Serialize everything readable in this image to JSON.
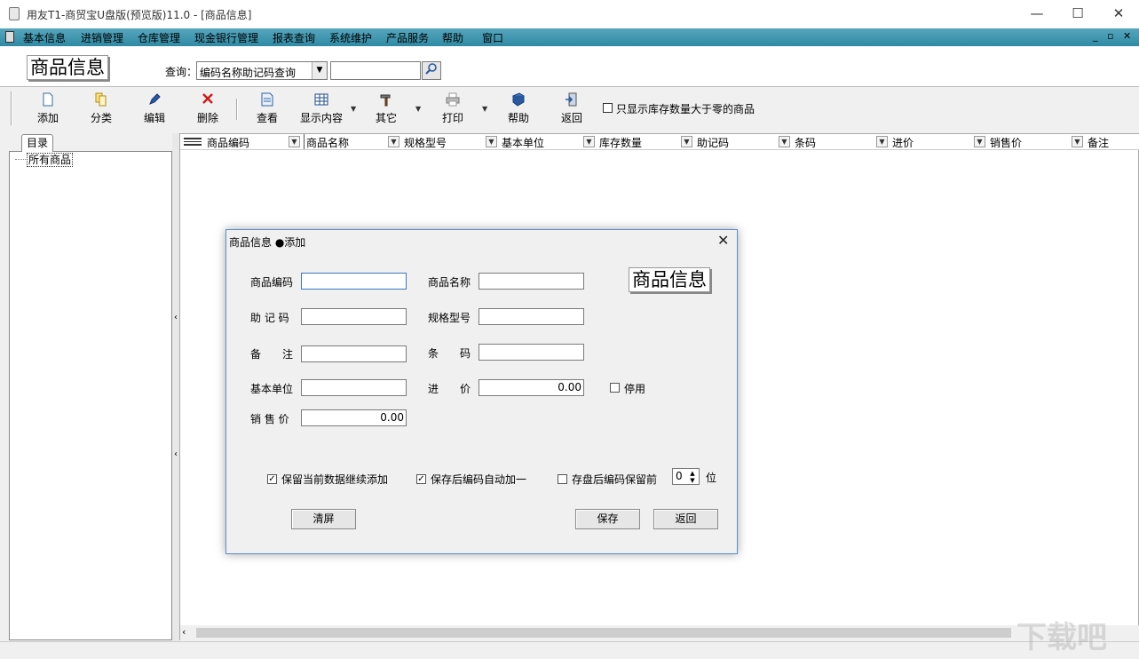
{
  "window": {
    "title": "用友T1-商贸宝U盘版(预览版)11.0 - [商品信息]",
    "minimize": "—",
    "maximize": "☐",
    "close": "✕"
  },
  "menu": [
    "基本信息",
    "进销管理",
    "仓库管理",
    "现金银行管理",
    "报表查询",
    "系统维护",
    "产品服务",
    "帮助",
    "窗口"
  ],
  "mdi_controls": {
    "minimize": "_",
    "restore": "▫",
    "close": "✕"
  },
  "header": {
    "logo": "商品信息",
    "query_label": "查询：",
    "query_mode": "编码名称助记码查询",
    "query_value": "",
    "query_icon": "search-icon"
  },
  "toolbar": {
    "buttons": [
      {
        "label": "添加",
        "icon": "page-icon"
      },
      {
        "label": "分类",
        "icon": "pages-icon"
      },
      {
        "label": "编辑",
        "icon": "pen-icon"
      },
      {
        "label": "删除",
        "icon": "red-x-icon"
      },
      {
        "label": "查看",
        "icon": "document-icon"
      },
      {
        "label": "显示内容",
        "icon": "grid-icon"
      },
      {
        "label": "其它",
        "icon": "hammer-icon"
      },
      {
        "label": "打印",
        "icon": "printer-icon"
      },
      {
        "label": "帮助",
        "icon": "book-icon"
      },
      {
        "label": "返回",
        "icon": "exit-door-icon"
      }
    ],
    "filter_checkbox": "只显示库存数量大于零的商品"
  },
  "tree": {
    "tab": "目录",
    "root": "所有商品"
  },
  "grid": {
    "columns": [
      "商品编码",
      "商品名称",
      "规格型号",
      "基本单位",
      "库存数量",
      "助记码",
      "条码",
      "进价",
      "销售价",
      "备注"
    ]
  },
  "dialog": {
    "title": "商品信息 ●添加",
    "logo": "商品信息",
    "fields": {
      "code": {
        "label": "商品编码",
        "value": ""
      },
      "name": {
        "label": "商品名称",
        "value": ""
      },
      "mnemonic": {
        "label": "助 记 码",
        "value": ""
      },
      "spec": {
        "label": "规格型号",
        "value": ""
      },
      "remark": {
        "label": "备　　注",
        "value": ""
      },
      "barcode": {
        "label": "条　　码",
        "value": ""
      },
      "unit": {
        "label": "基本单位",
        "value": ""
      },
      "cost": {
        "label": "进　　价",
        "value": "0.00"
      },
      "price": {
        "label": "销 售 价",
        "value": "0.00"
      }
    },
    "disabled_label": "停用",
    "options": {
      "keep_data": {
        "label": "保留当前数据继续添加",
        "checked": true
      },
      "auto_increment": {
        "label": "保存后编码自动加一",
        "checked": true
      },
      "keep_prefix": {
        "label": "存盘后编码保留前",
        "checked": false
      }
    },
    "prefix_digits": "0",
    "prefix_unit": "位",
    "buttons": {
      "clear": "清屏",
      "save": "保存",
      "back": "返回"
    }
  },
  "watermark": "下载吧"
}
